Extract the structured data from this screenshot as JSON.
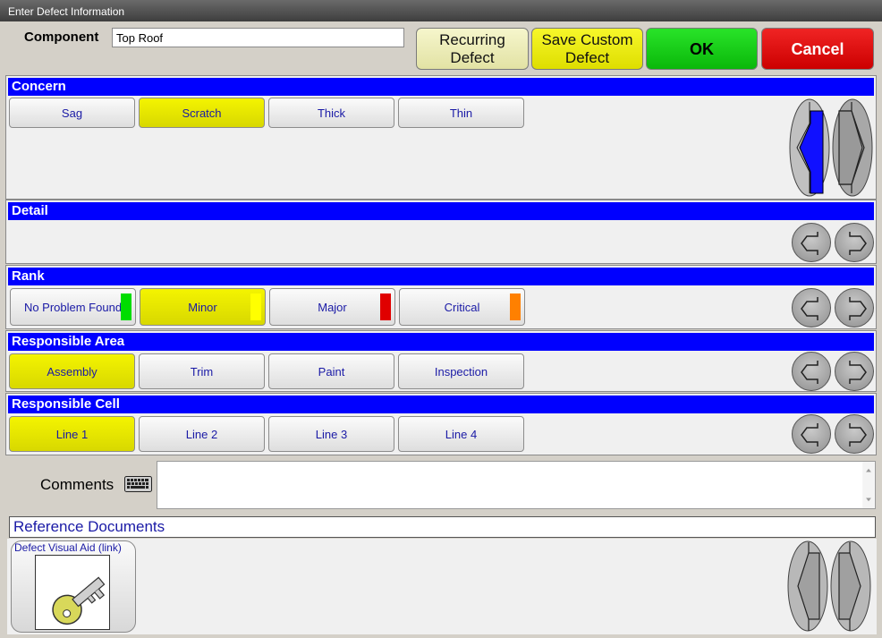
{
  "window": {
    "title": "Enter Defect Information"
  },
  "header": {
    "component_label": "Component",
    "component_value": "Top Roof",
    "buttons": {
      "recurring": "Recurring Defect",
      "save_custom": "Save Custom Defect",
      "ok": "OK",
      "cancel": "Cancel"
    }
  },
  "concern": {
    "title": "Concern",
    "options": [
      "Sag",
      "Scratch",
      "Thick",
      "Thin"
    ],
    "selected": "Scratch"
  },
  "detail": {
    "title": "Detail"
  },
  "rank": {
    "title": "Rank",
    "options": [
      {
        "label": "No Problem Found",
        "color": "#00dd00"
      },
      {
        "label": "Minor",
        "color": "#ffff00"
      },
      {
        "label": "Major",
        "color": "#e00000"
      },
      {
        "label": "Critical",
        "color": "#ff8000"
      }
    ],
    "selected": "Minor"
  },
  "responsible_area": {
    "title": "Responsible Area",
    "options": [
      "Assembly",
      "Trim",
      "Paint",
      "Inspection"
    ],
    "selected": "Assembly"
  },
  "responsible_cell": {
    "title": "Responsible Cell",
    "options": [
      "Line 1",
      "Line 2",
      "Line 3",
      "Line 4"
    ],
    "selected": "Line 1"
  },
  "comments": {
    "label": "Comments",
    "value": ""
  },
  "reference": {
    "title": "Reference Documents",
    "items": [
      "Defect Visual Aid (link)"
    ]
  },
  "icons": {
    "keyboard": "keyboard-icon",
    "key": "key-icon",
    "prev": "left-arrow-icon",
    "next": "right-arrow-icon"
  }
}
